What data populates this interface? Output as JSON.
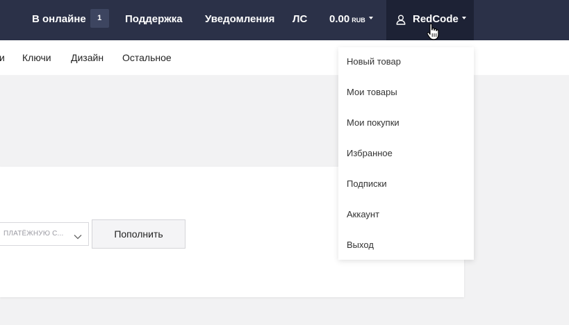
{
  "topbar": {
    "online_label": "В онлайне",
    "online_count": "1",
    "support_label": "Поддержка",
    "notifications_label": "Уведомления",
    "messages_label": "ЛС",
    "balance_amount": "0.00",
    "balance_unit": "RUB",
    "username": "RedCode"
  },
  "subnav": {
    "partial_item": "и",
    "items": [
      "Ключи",
      "Дизайн",
      "Остальное"
    ]
  },
  "card": {
    "payment_select_text": "ПЛАТЁЖНУЮ С...",
    "topup_button": "Пополнить"
  },
  "user_menu": {
    "items": [
      "Новый товар",
      "Мои товары",
      "Мои покупки",
      "Избранное",
      "Подписки",
      "Аккаунт",
      "Выход"
    ]
  },
  "colors": {
    "topbar_bg": "#2b3148",
    "user_block_bg": "#1d2235",
    "page_bg": "#f2f2f3"
  },
  "icons": {
    "user": "user-outline-icon",
    "cursor": "hand-pointer-icon",
    "select": "chevron-down-icon"
  }
}
